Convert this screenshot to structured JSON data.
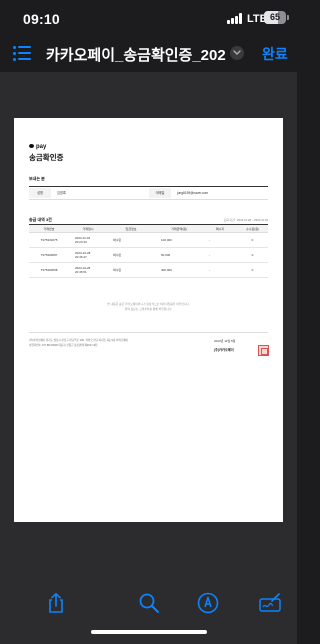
{
  "status_bar": {
    "time": "09:10",
    "network": "LTE",
    "battery": "65"
  },
  "nav": {
    "title": "카카오페이_송금확인증_20231…",
    "done_label": "완료"
  },
  "document": {
    "brand": "pay",
    "heading": "송금확인증",
    "sender_section": "보내는 분",
    "sender": {
      "name_label": "성명",
      "name_value": "임영록",
      "email_label": "이메일",
      "email_value": "jung8159@naver.com"
    },
    "tx_section": "송금 내역 3건",
    "query_period": "조회 기간 : 2023.10.28 ~ 2023.11.04",
    "columns": [
      "거래번호",
      "거래일시",
      "입금정보",
      "거래금액(원)",
      "메시지",
      "수수료(원)"
    ],
    "rows": [
      {
        "id": "T375333275",
        "datetime": "2023-11-04\n20:24:33",
        "recipient": "박수민",
        "amount": "100,000",
        "message": "-",
        "fee": "0"
      },
      {
        "id": "T375393687",
        "datetime": "2023-10-28\n20:46:47",
        "recipient": "박수민",
        "amount": "50,000",
        "message": "-",
        "fee": "0"
      },
      {
        "id": "T375393658",
        "datetime": "2023-10-28\n20:45:51",
        "recipient": "박수민",
        "amount": "400,000",
        "message": "-",
        "fee": "0"
      }
    ],
    "notice": "본 내용은 송금 카카오페이머니가 정상적으로 처리되었음을 확인합니다.\n위의 정보는 고객센터를 통해 확인됩니다.",
    "footer_company": "(주)카카오페이  경기도 성남시 분당구 판교역로 166, 카카오 판교 아지트 A동 5층 카카오페이\n사업자번호 137-88-00000  대표자 신원근  통신판매 제2017-9천",
    "footer_date": "2023년 11월 5일",
    "footer_name": "(주)카카오페이"
  },
  "icons": {
    "list": "list-icon",
    "chevron": "chevron-down-icon",
    "share": "share-icon",
    "search": "search-icon",
    "markup": "markup-icon",
    "signature": "signature-icon"
  },
  "colors": {
    "accent": "#0a84ff",
    "chrome": "#1c1c1e",
    "toolbar": "#2c2c2e",
    "seal": "#d9534f"
  }
}
